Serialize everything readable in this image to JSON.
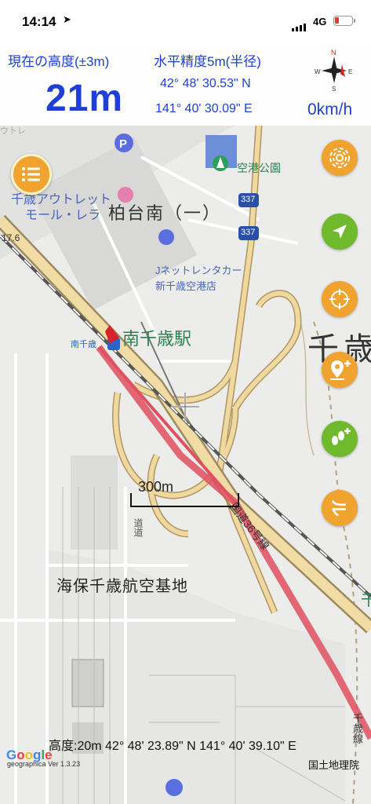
{
  "status_bar": {
    "time": "14:14",
    "network": "4G"
  },
  "info": {
    "altitude_label": "現在の高度(±3m)",
    "altitude_value": "21m",
    "accuracy_label": "水平精度5m(半径)",
    "latitude": "42° 48' 30.53\" N",
    "longitude": "141° 40' 30.09\" E",
    "speed": "0km/h"
  },
  "map": {
    "labels": {
      "top_tag": "ウトレ",
      "outlet1": "千歳アウトレット",
      "outlet2": "モール・レラ",
      "district": "柏台南（一）",
      "park": "空港公園",
      "rental1": "Jネットレンタカー",
      "rental2": "新千歳空港店",
      "station": "南千歳駅",
      "station_small": "南千歳",
      "area_big": "千歳",
      "base": "海保千歳航空基地",
      "route_badge": "337",
      "route_badge2": "337",
      "national_road": "国道36号線",
      "rail_label": "千歳線",
      "elev": "17.6",
      "road_side": "道道",
      "green_text": "千"
    },
    "scale": "300m",
    "center_info": "高度:20m  42° 48' 23.89\" N 141° 40' 39.10\" E",
    "attribution_google": [
      "G",
      "o",
      "o",
      "g",
      "l",
      "e"
    ],
    "version": "geographica Ver 1.3.23",
    "attribution_gsi": "国土地理院"
  },
  "buttons": {
    "menu": "menu-icon",
    "layers": "spiral-icon",
    "locate": "location-arrow-icon",
    "crosshair": "crosshair-icon",
    "add_pin": "add-pin-icon",
    "add_track": "footsteps-add-icon",
    "record": "ru-icon",
    "record_label": "ル"
  },
  "colors": {
    "accent": "#1f3fd6",
    "orange": "#f0a32e",
    "green": "#6fba2c",
    "track": "#e05060"
  }
}
